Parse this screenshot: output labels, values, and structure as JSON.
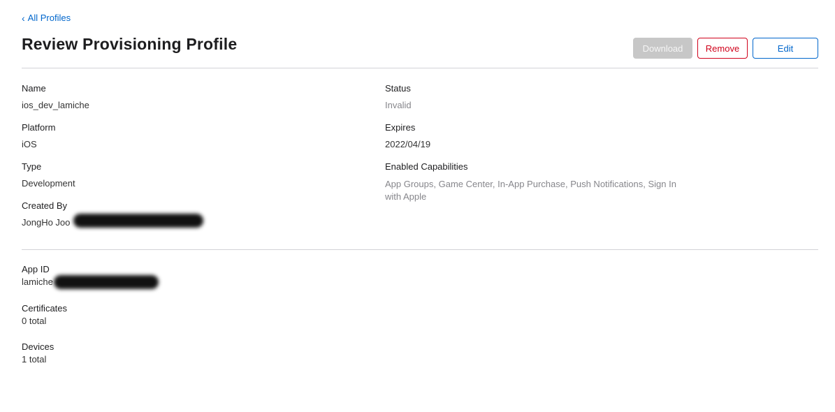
{
  "nav": {
    "back_label": "All Profiles"
  },
  "header": {
    "title": "Review Provisioning Profile"
  },
  "actions": {
    "download": "Download",
    "remove": "Remove",
    "edit": "Edit"
  },
  "details": {
    "name": {
      "label": "Name",
      "value": "ios_dev_lamiche"
    },
    "platform": {
      "label": "Platform",
      "value": "iOS"
    },
    "type": {
      "label": "Type",
      "value": "Development"
    },
    "created_by": {
      "label": "Created By",
      "value": "JongHo Joo"
    },
    "status": {
      "label": "Status",
      "value": "Invalid"
    },
    "expires": {
      "label": "Expires",
      "value": "2022/04/19"
    },
    "capabilities": {
      "label": "Enabled Capabilities",
      "value": "App Groups, Game Center, In-App Purchase, Push Notifications, Sign In with Apple"
    }
  },
  "summary": {
    "app_id": {
      "label": "App ID",
      "value": "lamiche"
    },
    "certificates": {
      "label": "Certificates",
      "value": "0 total"
    },
    "devices": {
      "label": "Devices",
      "value": "1 total"
    }
  },
  "colors": {
    "link": "#0066cc",
    "danger": "#d0021b",
    "disabled": "#c7c7c7",
    "divider": "#d2d2d7"
  }
}
